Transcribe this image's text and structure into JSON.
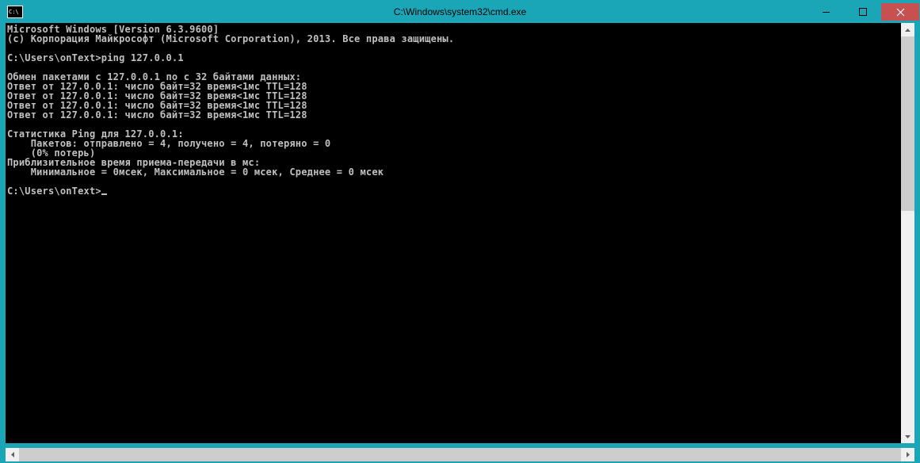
{
  "window": {
    "title": "C:\\Windows\\system32\\cmd.exe"
  },
  "terminal": {
    "lines": [
      "Microsoft Windows [Version 6.3.9600]",
      "(c) Корпорация Майкрософт (Microsoft Corporation), 2013. Все права защищены.",
      "",
      "C:\\Users\\onText>ping 127.0.0.1",
      "",
      "Обмен пакетами с 127.0.0.1 по с 32 байтами данных:",
      "Ответ от 127.0.0.1: число байт=32 время<1мс TTL=128",
      "Ответ от 127.0.0.1: число байт=32 время<1мс TTL=128",
      "Ответ от 127.0.0.1: число байт=32 время<1мс TTL=128",
      "Ответ от 127.0.0.1: число байт=32 время<1мс TTL=128",
      "",
      "Статистика Ping для 127.0.0.1:",
      "    Пакетов: отправлено = 4, получено = 4, потеряно = 0",
      "    (0% потерь)",
      "Приблизительное время приема-передачи в мс:",
      "    Минимальное = 0мсек, Максимальное = 0 мсек, Среднее = 0 мсек",
      ""
    ],
    "prompt": "C:\\Users\\onText>"
  },
  "colors": {
    "titlebar": "#1aa6b7",
    "close": "#c75050",
    "terminal_bg": "#000000",
    "terminal_fg": "#c0c0c0",
    "scrollbar_track": "#f0f0f0",
    "scrollbar_thumb": "#cdcdcd"
  }
}
